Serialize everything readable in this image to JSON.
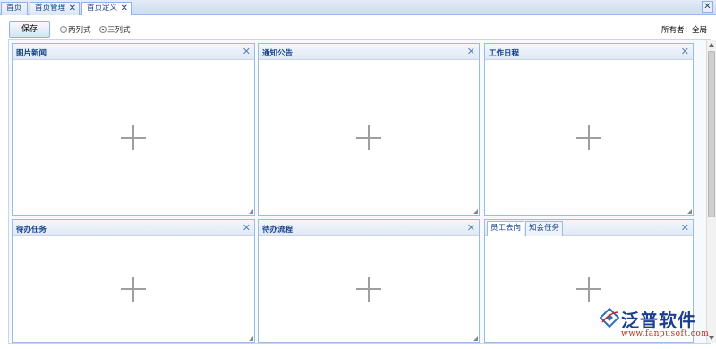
{
  "tabs": [
    {
      "label": "首页",
      "closable": false
    },
    {
      "label": "首页管理",
      "closable": true
    },
    {
      "label": "首页定义",
      "closable": true,
      "active": true
    }
  ],
  "tab_close_glyph": "✕",
  "toolbar": {
    "save_label": "保存",
    "layout_options": [
      {
        "label": "两列式",
        "selected": false
      },
      {
        "label": "三列式",
        "selected": true
      }
    ],
    "owner_label": "所有者：全局"
  },
  "panels": [
    {
      "title": "图片新闻"
    },
    {
      "title": "通知公告"
    },
    {
      "title": "工作日程"
    },
    {
      "title": "待办任务"
    },
    {
      "title": "待办流程"
    },
    {
      "subtabs": [
        "员工去向",
        "知会任务"
      ]
    }
  ],
  "panel_close_glyph": "✕",
  "logo": {
    "name": "泛普软件",
    "url": "www.fanpusoft.com",
    "colors": {
      "text": "#1b3f8f",
      "url": "#c62828",
      "mark": "#2f6fb8"
    }
  },
  "colors": {
    "accent": "#15428b",
    "border": "#99bbe8",
    "plus": "#9e9e9e"
  }
}
